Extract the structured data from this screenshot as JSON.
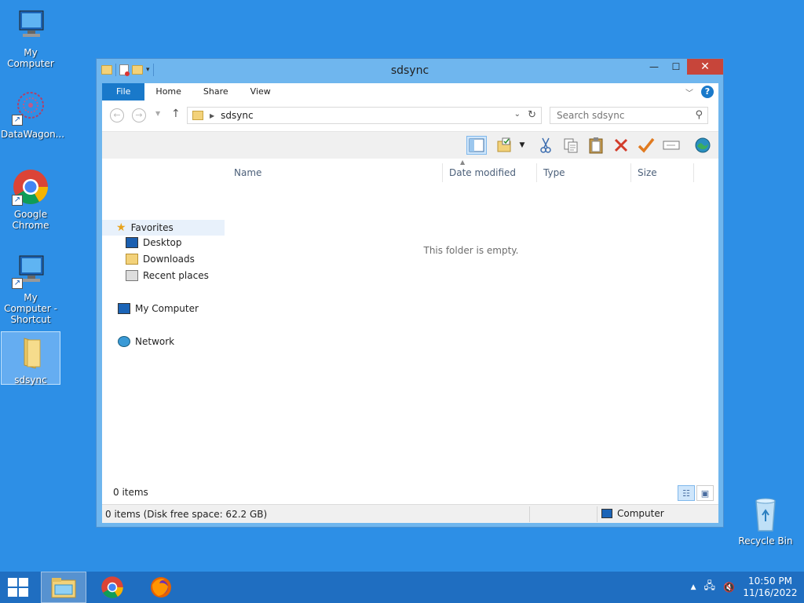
{
  "desktop": {
    "icons": [
      {
        "label": "My Computer"
      },
      {
        "label": "DataWagon..."
      },
      {
        "label": "Google Chrome"
      },
      {
        "label": "My Computer - Shortcut"
      },
      {
        "label": "sdsync"
      },
      {
        "label": "Recycle Bin"
      }
    ]
  },
  "window": {
    "title": "sdsync",
    "controls": {
      "minimize": "—",
      "maximize": "☐",
      "close": "✕"
    },
    "ribbon_tabs": [
      {
        "label": "File"
      },
      {
        "label": "Home"
      },
      {
        "label": "Share"
      },
      {
        "label": "View"
      }
    ],
    "help": "?",
    "address": {
      "path": "sdsync"
    },
    "search": {
      "placeholder": "Search sdsync"
    },
    "nav_pane": {
      "favorites": "Favorites",
      "desktop": "Desktop",
      "downloads": "Downloads",
      "recent": "Recent places",
      "computer": "My Computer",
      "network": "Network"
    },
    "columns": [
      {
        "label": "Name"
      },
      {
        "label": "Date modified"
      },
      {
        "label": "Type"
      },
      {
        "label": "Size"
      }
    ],
    "empty_message": "This folder is empty.",
    "items_count": "0 items",
    "status": {
      "left": "0 items (Disk free space: 62.2 GB)",
      "right": "Computer"
    }
  },
  "taskbar": {
    "clock_time": "10:50 PM",
    "clock_date": "11/16/2022"
  },
  "colors": {
    "desktop_bg": "#2d8fe6",
    "window_frame": "#6fb6ee",
    "file_tab": "#1979ca",
    "close_button": "#c7453a",
    "taskbar": "#1f6ec1"
  }
}
